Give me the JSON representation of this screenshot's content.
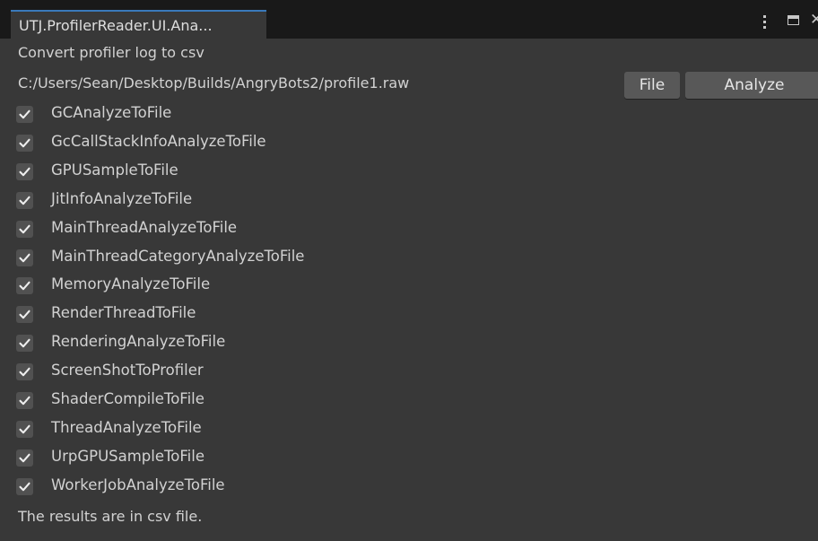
{
  "window": {
    "tab_title": "UTJ.ProfilerReader.UI.Ana...",
    "menu_icon": "kebab-menu-icon",
    "maximize_icon": "maximize-icon",
    "close_icon": "close-icon"
  },
  "header": {
    "title": "Convert profiler log to csv"
  },
  "file": {
    "path": "C:/Users/Sean/Desktop/Builds/AngryBots2/profile1.raw",
    "file_button": "File",
    "analyze_button": "Analyze"
  },
  "options": [
    {
      "label": "GCAnalyzeToFile",
      "checked": true
    },
    {
      "label": "GcCallStackInfoAnalyzeToFile",
      "checked": true
    },
    {
      "label": "GPUSampleToFile",
      "checked": true
    },
    {
      "label": "JitInfoAnalyzeToFile",
      "checked": true
    },
    {
      "label": "MainThreadAnalyzeToFile",
      "checked": true
    },
    {
      "label": "MainThreadCategoryAnalyzeToFile",
      "checked": true
    },
    {
      "label": "MemoryAnalyzeToFile",
      "checked": true
    },
    {
      "label": "RenderThreadToFile",
      "checked": true
    },
    {
      "label": "RenderingAnalyzeToFile",
      "checked": true
    },
    {
      "label": "ScreenShotToProfiler",
      "checked": true
    },
    {
      "label": "ShaderCompileToFile",
      "checked": true
    },
    {
      "label": "ThreadAnalyzeToFile",
      "checked": true
    },
    {
      "label": "UrpGPUSampleToFile",
      "checked": true
    },
    {
      "label": "WorkerJobAnalyzeToFile",
      "checked": true
    }
  ],
  "footer": {
    "status": "The results are in csv file."
  },
  "colors": {
    "background": "#383838",
    "tabbar": "#191919",
    "tab_accent": "#3a79bb",
    "button": "#585858",
    "checkbox": "#515151"
  }
}
